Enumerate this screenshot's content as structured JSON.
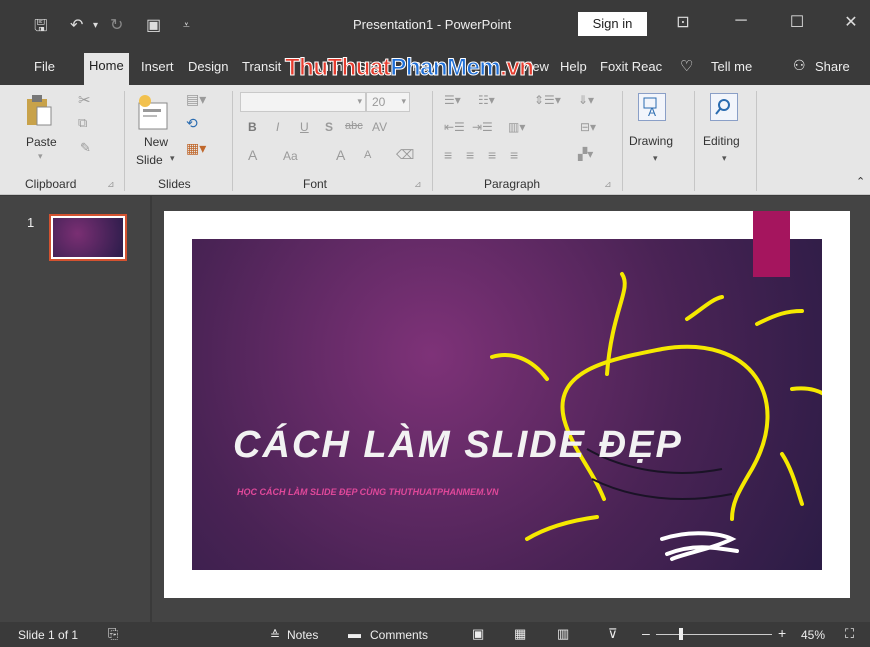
{
  "titlebar": {
    "title": "Presentation1  -  PowerPoint",
    "signin": "Sign in",
    "qat": {
      "save": "save-icon",
      "undo": "undo-icon",
      "redo": "redo-icon",
      "present": "present-icon",
      "customize": "customize-icon"
    }
  },
  "tabs": [
    "File",
    "Home",
    "Insert",
    "Design",
    "Transit",
    "Anim",
    "Slide",
    "Revi",
    "View",
    "Help",
    "Foxit Reac"
  ],
  "tellme": "Tell me",
  "share": "Share",
  "watermark": {
    "part1": "ThuThuat",
    "part2": "PhanMem",
    "part3": ".vn"
  },
  "ribbon": {
    "clipboard": {
      "label": "Clipboard",
      "paste": "Paste"
    },
    "slides": {
      "label": "Slides",
      "new_slide_line1": "New",
      "new_slide_line2": "Slide"
    },
    "font": {
      "label": "Font",
      "size": "20",
      "bold": "B",
      "italic": "I",
      "underline": "U",
      "shadow": "S",
      "strike": "abc",
      "spacing": "AV",
      "size_up": "A",
      "size_down": "A",
      "aa": "Aa"
    },
    "paragraph": {
      "label": "Paragraph"
    },
    "drawing": {
      "label": "Drawing"
    },
    "editing": {
      "label": "Editing"
    }
  },
  "thumbnail": {
    "number": "1"
  },
  "slide": {
    "title": "CÁCH LÀM SLIDE ĐẸP",
    "subtitle": "HỌC CÁCH LÀM SLIDE ĐẸP CÙNG THUTHUATPHANMEM.VN"
  },
  "status": {
    "slide_of": "Slide 1 of 1",
    "notes": "Notes",
    "comments": "Comments",
    "zoom": "45%"
  },
  "colors": {
    "accent": "#d35230",
    "pink": "#a5155e",
    "bulb": "#f5e900"
  }
}
